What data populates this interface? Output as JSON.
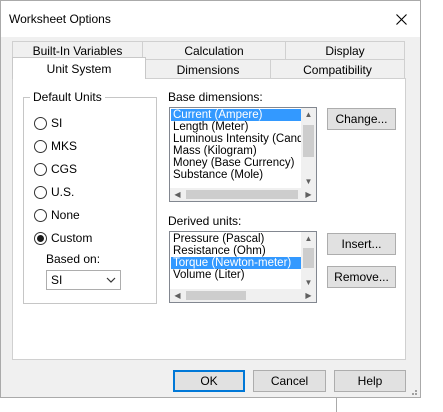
{
  "window": {
    "title": "Worksheet Options"
  },
  "tabs": {
    "back_row": [
      "Built-In Variables",
      "Calculation",
      "Display"
    ],
    "front_row": [
      "Unit System",
      "Dimensions",
      "Compatibility"
    ],
    "active": "Unit System"
  },
  "default_units": {
    "label": "Default Units",
    "options": [
      "SI",
      "MKS",
      "CGS",
      "U.S.",
      "None",
      "Custom"
    ],
    "selected": "Custom",
    "based_on_label": "Based on:",
    "based_on_value": "SI"
  },
  "base_dimensions": {
    "label": "Base dimensions:",
    "items": [
      "Current (Ampere)",
      "Length (Meter)",
      "Luminous Intensity (Candela)",
      "Mass (Kilogram)",
      "Money (Base Currency)",
      "Substance (Mole)"
    ],
    "selected": "Current (Ampere)",
    "change_button": "Change..."
  },
  "derived_units": {
    "label": "Derived units:",
    "items": [
      "Pressure (Pascal)",
      "Resistance (Ohm)",
      "Torque (Newton-meter)",
      "Volume (Liter)"
    ],
    "selected": "Torque (Newton-meter)",
    "insert_button": "Insert...",
    "remove_button": "Remove..."
  },
  "footer": {
    "ok": "OK",
    "cancel": "Cancel",
    "help": "Help"
  },
  "icons": {
    "close": "close-icon",
    "dropdown": "chevron-down-icon",
    "grip": "resize-grip-icon"
  },
  "colors": {
    "selection": "#3399ff",
    "default_button_border": "#0078d7"
  }
}
